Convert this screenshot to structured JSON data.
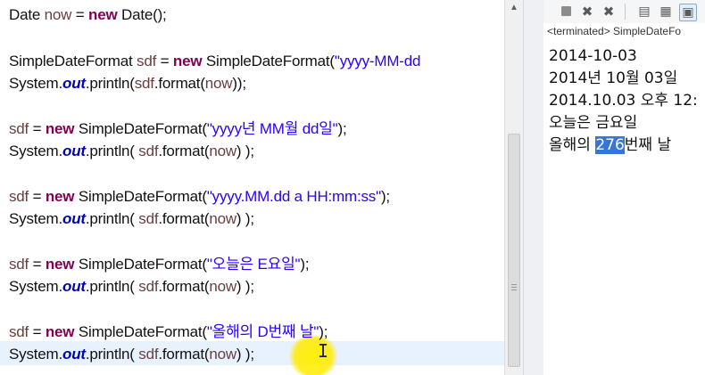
{
  "editor": {
    "lines": [
      {
        "parts": [
          {
            "t": "Date ",
            "c": "plain"
          },
          {
            "t": "now",
            "c": "var"
          },
          {
            "t": " = ",
            "c": "plain"
          },
          {
            "t": "new",
            "c": "kw"
          },
          {
            "t": " Date();",
            "c": "plain"
          }
        ]
      },
      {
        "parts": [
          {
            "t": "SimpleDateFormat ",
            "c": "plain"
          },
          {
            "t": "sdf",
            "c": "var"
          },
          {
            "t": " = ",
            "c": "plain"
          },
          {
            "t": "new",
            "c": "kw"
          },
          {
            "t": " SimpleDateFormat(",
            "c": "plain"
          },
          {
            "t": "\"yyyy-MM-dd",
            "c": "str"
          }
        ]
      },
      {
        "parts": [
          {
            "t": "System.",
            "c": "plain"
          },
          {
            "t": "out",
            "c": "fld"
          },
          {
            "t": ".println(",
            "c": "plain"
          },
          {
            "t": "sdf",
            "c": "var"
          },
          {
            "t": ".format(",
            "c": "plain"
          },
          {
            "t": "now",
            "c": "var"
          },
          {
            "t": "));",
            "c": "plain"
          }
        ]
      },
      {
        "parts": [
          {
            "t": "sdf",
            "c": "var"
          },
          {
            "t": " = ",
            "c": "plain"
          },
          {
            "t": "new",
            "c": "kw"
          },
          {
            "t": " SimpleDateFormat(",
            "c": "plain"
          },
          {
            "t": "\"yyyy년 MM월 dd일\"",
            "c": "str"
          },
          {
            "t": ");",
            "c": "plain"
          }
        ]
      },
      {
        "parts": [
          {
            "t": "System.",
            "c": "plain"
          },
          {
            "t": "out",
            "c": "fld"
          },
          {
            "t": ".println( ",
            "c": "plain"
          },
          {
            "t": "sdf",
            "c": "var"
          },
          {
            "t": ".format(",
            "c": "plain"
          },
          {
            "t": "now",
            "c": "var"
          },
          {
            "t": ") );",
            "c": "plain"
          }
        ]
      },
      {
        "parts": [
          {
            "t": "sdf",
            "c": "var"
          },
          {
            "t": " = ",
            "c": "plain"
          },
          {
            "t": "new",
            "c": "kw"
          },
          {
            "t": " SimpleDateFormat(",
            "c": "plain"
          },
          {
            "t": "\"yyyy.MM.dd a HH:mm:ss\"",
            "c": "str"
          },
          {
            "t": ");",
            "c": "plain"
          }
        ]
      },
      {
        "parts": [
          {
            "t": "System.",
            "c": "plain"
          },
          {
            "t": "out",
            "c": "fld"
          },
          {
            "t": ".println( ",
            "c": "plain"
          },
          {
            "t": "sdf",
            "c": "var"
          },
          {
            "t": ".format(",
            "c": "plain"
          },
          {
            "t": "now",
            "c": "var"
          },
          {
            "t": ") );",
            "c": "plain"
          }
        ]
      },
      {
        "parts": [
          {
            "t": "sdf",
            "c": "var"
          },
          {
            "t": " = ",
            "c": "plain"
          },
          {
            "t": "new",
            "c": "kw"
          },
          {
            "t": " SimpleDateFormat(",
            "c": "plain"
          },
          {
            "t": "\"오늘은 E요일\"",
            "c": "str"
          },
          {
            "t": ");",
            "c": "plain"
          }
        ]
      },
      {
        "parts": [
          {
            "t": "System.",
            "c": "plain"
          },
          {
            "t": "out",
            "c": "fld"
          },
          {
            "t": ".println( ",
            "c": "plain"
          },
          {
            "t": "sdf",
            "c": "var"
          },
          {
            "t": ".format(",
            "c": "plain"
          },
          {
            "t": "now",
            "c": "var"
          },
          {
            "t": ") );",
            "c": "plain"
          }
        ]
      },
      {
        "parts": [
          {
            "t": "sdf",
            "c": "var"
          },
          {
            "t": " = ",
            "c": "plain"
          },
          {
            "t": "new",
            "c": "kw"
          },
          {
            "t": " SimpleDateFormat(",
            "c": "plain"
          },
          {
            "t": "\"올해의 D번째 날\"",
            "c": "str"
          },
          {
            "t": ");",
            "c": "plain"
          }
        ]
      },
      {
        "parts": [
          {
            "t": "System.",
            "c": "plain"
          },
          {
            "t": "out",
            "c": "fld"
          },
          {
            "t": ".println( ",
            "c": "plain"
          },
          {
            "t": "sdf",
            "c": "var"
          },
          {
            "t": ".format(",
            "c": "plain"
          },
          {
            "t": "now",
            "c": "var"
          },
          {
            "t": ") );",
            "c": "plain"
          }
        ]
      }
    ]
  },
  "console": {
    "toolbar": {
      "stop_icon": "stop-icon",
      "remove_icon": "remove-launch-icon",
      "remove_all_icon": "remove-all-terminated-icon",
      "clear_icon": "clear-console-icon",
      "scroll_lock_icon": "scroll-lock-icon",
      "pin_icon": "pin-console-icon"
    },
    "terminated_label": "<terminated> SimpleDateFo",
    "output": [
      "2014-10-03",
      "2014년 10월 03일",
      "2014.10.03 오후 12:",
      "오늘은 금요일"
    ],
    "last_line": {
      "before": "올해의 ",
      "selected": "276",
      "after": "번째 날"
    }
  },
  "colors": {
    "keyword": "#7f0055",
    "string": "#2a00ff",
    "static_field": "#0000c0",
    "local_var": "#6a3e3e",
    "selection": "#3875d7",
    "current_line": "#e8f2fe"
  }
}
